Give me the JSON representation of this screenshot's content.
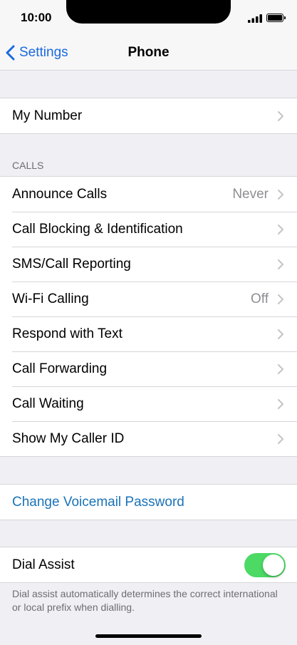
{
  "status_bar": {
    "time": "10:00"
  },
  "nav": {
    "back_label": "Settings",
    "title": "Phone"
  },
  "group_number": {
    "items": [
      {
        "label": "My Number",
        "value": ""
      }
    ]
  },
  "calls": {
    "header": "CALLS",
    "items": [
      {
        "label": "Announce Calls",
        "value": "Never"
      },
      {
        "label": "Call Blocking & Identification",
        "value": ""
      },
      {
        "label": "SMS/Call Reporting",
        "value": ""
      },
      {
        "label": "Wi-Fi Calling",
        "value": "Off"
      },
      {
        "label": "Respond with Text",
        "value": ""
      },
      {
        "label": "Call Forwarding",
        "value": ""
      },
      {
        "label": "Call Waiting",
        "value": ""
      },
      {
        "label": "Show My Caller ID",
        "value": ""
      }
    ]
  },
  "voicemail": {
    "label": "Change Voicemail Password"
  },
  "dial_assist": {
    "label": "Dial Assist",
    "enabled": true,
    "footer": "Dial assist automatically determines the correct international or local prefix when dialling."
  },
  "colors": {
    "accent": "#1a6ae0",
    "link": "#1a73b8",
    "toggle_on": "#4cd964",
    "background": "#efeff4"
  },
  "icons": {
    "back": "chevron-left-icon",
    "disclosure": "chevron-right-icon"
  }
}
